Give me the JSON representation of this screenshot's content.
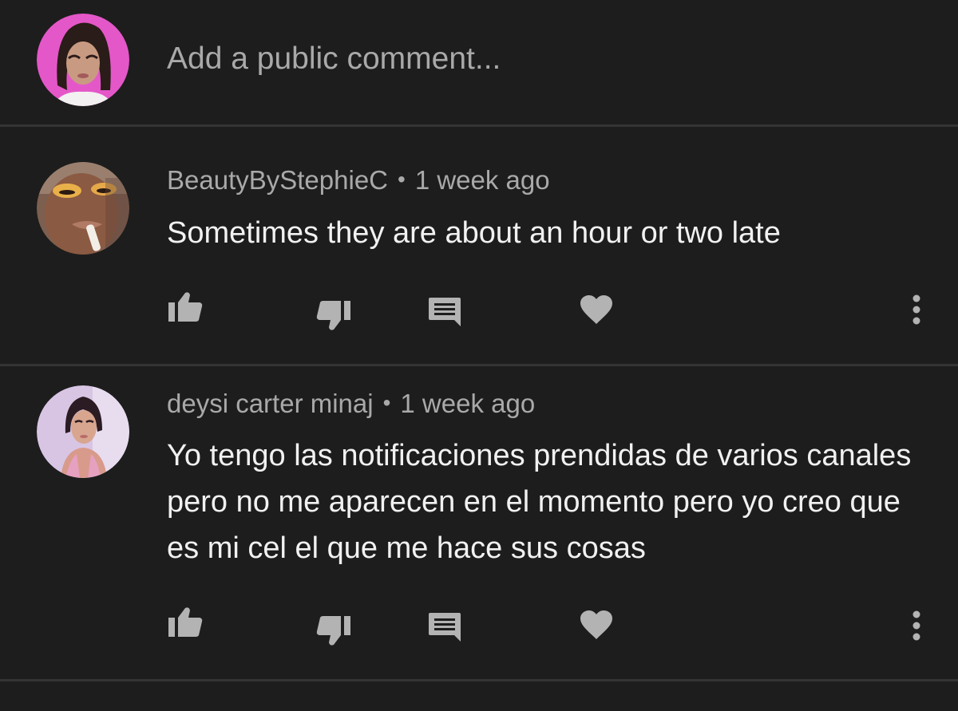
{
  "composer": {
    "placeholder": "Add a public comment..."
  },
  "separator": "•",
  "comments": [
    {
      "author": "BeautyByStephieC",
      "time": "1 week ago",
      "text": "Sometimes they are about an hour or two late"
    },
    {
      "author": "deysi carter minaj",
      "time": "1 week ago",
      "text": "Yo tengo las notificaciones prendidas de varios canales pero no me aparecen en el momento pero yo creo que es mi cel el que me hace sus cosas"
    }
  ],
  "icons": {
    "like": "thumb-up-icon",
    "dislike": "thumb-down-icon",
    "reply": "comment-icon",
    "heart": "heart-icon",
    "more": "more-vertical-icon"
  },
  "colors": {
    "background": "#1d1d1d",
    "divider": "#343434",
    "primary_text": "#f1f1f1",
    "secondary_text": "#a9a9a9",
    "icon": "#b3b3b3"
  }
}
